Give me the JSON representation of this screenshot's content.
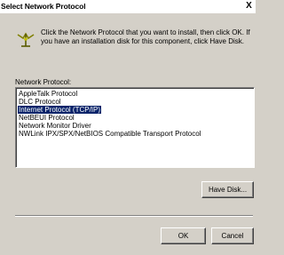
{
  "window": {
    "title": "Select Network Protocol",
    "close_label": "X"
  },
  "instruction": "Click the Network Protocol that you want to install, then click OK. If you have an installation disk for this component, click Have Disk.",
  "list_label": "Network Protocol:",
  "protocols": [
    "AppleTalk Protocol",
    "DLC Protocol",
    "Internet Protocol (TCP/IP)",
    "NetBEUI Protocol",
    "Network Monitor Driver",
    "NWLink IPX/SPX/NetBIOS Compatible Transport Protocol"
  ],
  "selected_index": 2,
  "buttons": {
    "have_disk": "Have Disk...",
    "ok": "OK",
    "cancel": "Cancel"
  }
}
